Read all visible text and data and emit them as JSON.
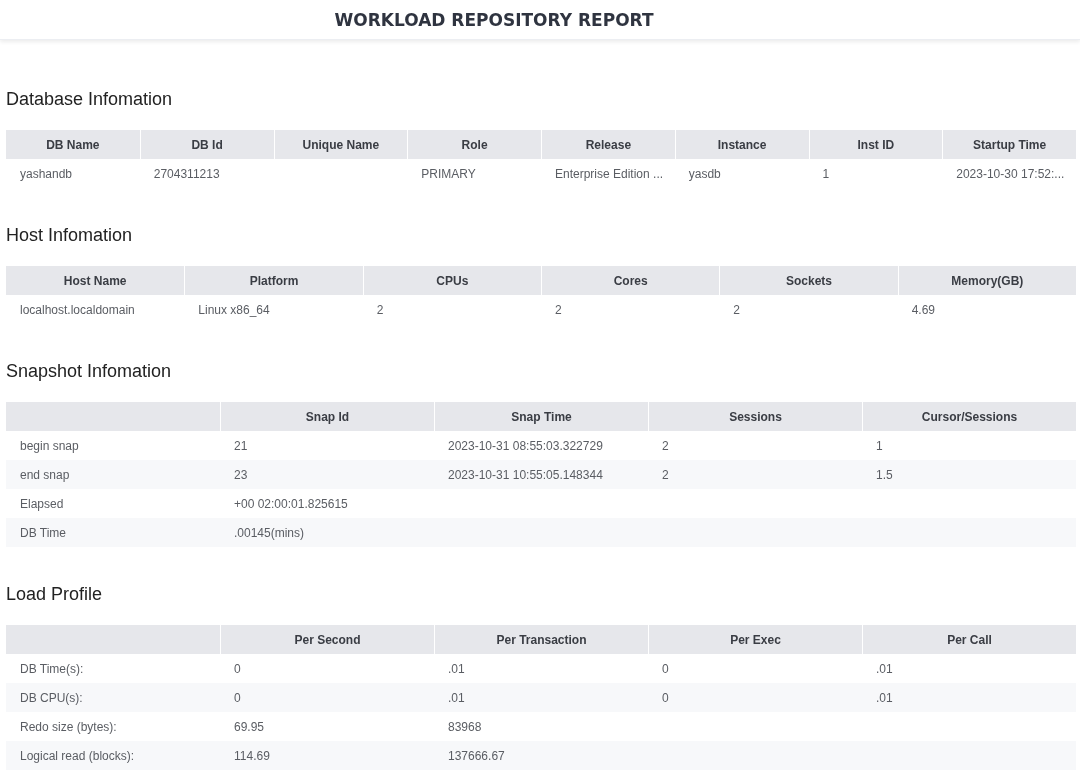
{
  "header": {
    "title": "WORKLOAD REPOSITORY REPORT"
  },
  "sections": [
    {
      "title": "Database Infomation",
      "table": {
        "kind": "plain",
        "columns": [
          "DB Name",
          "DB Id",
          "Unique Name",
          "Role",
          "Release",
          "Instance",
          "Inst ID",
          "Startup Time"
        ],
        "rows": [
          {
            "cells": [
              "yashandb",
              "2704311213",
              null,
              "PRIMARY",
              "Enterprise Edition ...",
              "yasdb",
              "1",
              "2023-10-30 17:52:..."
            ]
          }
        ]
      }
    },
    {
      "title": "Host Infomation",
      "table": {
        "kind": "plain",
        "columns": [
          "Host Name",
          "Platform",
          "CPUs",
          "Cores",
          "Sockets",
          "Memory(GB)"
        ],
        "rows": [
          {
            "cells": [
              "localhost.localdomain",
              "Linux x86_64",
              "2",
              "2",
              "2",
              "4.69"
            ]
          }
        ]
      }
    },
    {
      "title": "Snapshot Infomation",
      "table": {
        "kind": "labeled",
        "columns": [
          "Snap Id",
          "Snap Time",
          "Sessions",
          "Cursor/Sessions"
        ],
        "rows": [
          {
            "label": "begin snap",
            "cells": [
              "21",
              "2023-10-31 08:55:03.322729",
              "2",
              "1"
            ]
          },
          {
            "label": "end snap",
            "cells": [
              "23",
              "2023-10-31 10:55:05.148344",
              "2",
              "1.5"
            ]
          },
          {
            "label": "Elapsed",
            "cells": [
              "+00 02:00:01.825615"
            ]
          },
          {
            "label": "DB Time",
            "cells": [
              ".00145(mins)"
            ]
          }
        ]
      }
    },
    {
      "title": "Load Profile",
      "table": {
        "kind": "labeled",
        "columns": [
          "Per Second",
          "Per Transaction",
          "Per Exec",
          "Per Call"
        ],
        "rows": [
          {
            "label": "DB Time(s):",
            "cells": [
              "0",
              ".01",
              "0",
              ".01"
            ]
          },
          {
            "label": "DB CPU(s):",
            "cells": [
              "0",
              ".01",
              "0",
              ".01"
            ]
          },
          {
            "label": "Redo size (bytes):",
            "cells": [
              "69.95",
              "83968"
            ]
          },
          {
            "label": "Logical read (blocks):",
            "cells": [
              "114.69",
              "137666.67"
            ]
          }
        ]
      }
    }
  ]
}
